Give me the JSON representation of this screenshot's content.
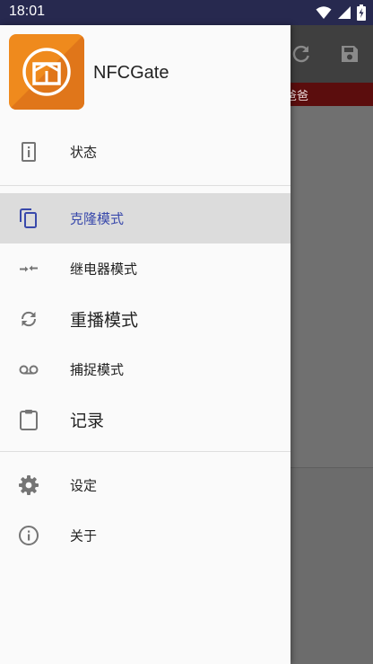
{
  "status_bar": {
    "time": "18:01",
    "icons": [
      "wifi-icon",
      "cell-signal-icon",
      "battery-charging-icon"
    ]
  },
  "background_app": {
    "actions": [
      "refresh-icon",
      "save-icon"
    ],
    "strip_text": "爸爸",
    "colors": {
      "toolbar": "#3f3f3f",
      "strip": "#5b0d0d"
    }
  },
  "drawer": {
    "app_name": "NFCGate",
    "logo_icon": "nfcgate-logo-icon",
    "items": [
      {
        "id": "status",
        "label": "状态",
        "icon": "device-info-icon",
        "selected": false
      },
      {
        "id": "clone",
        "label": "克隆模式",
        "icon": "copy-icon",
        "selected": true
      },
      {
        "id": "relay",
        "label": "继电器模式",
        "icon": "relay-arrows-icon",
        "selected": false
      },
      {
        "id": "replay",
        "label": "重播模式",
        "icon": "sync-icon",
        "selected": false
      },
      {
        "id": "capture",
        "label": "捕捉模式",
        "icon": "voicemail-icon",
        "selected": false
      },
      {
        "id": "logs",
        "label": "记录",
        "icon": "clipboard-icon",
        "selected": false
      },
      {
        "id": "settings",
        "label": "设定",
        "icon": "settings-icon",
        "selected": false
      },
      {
        "id": "about",
        "label": "关于",
        "icon": "info-icon",
        "selected": false
      }
    ],
    "colors": {
      "accent": "#3949ab",
      "selected_bg": "#dcdcdc",
      "logo": "#ef8a1d"
    }
  }
}
